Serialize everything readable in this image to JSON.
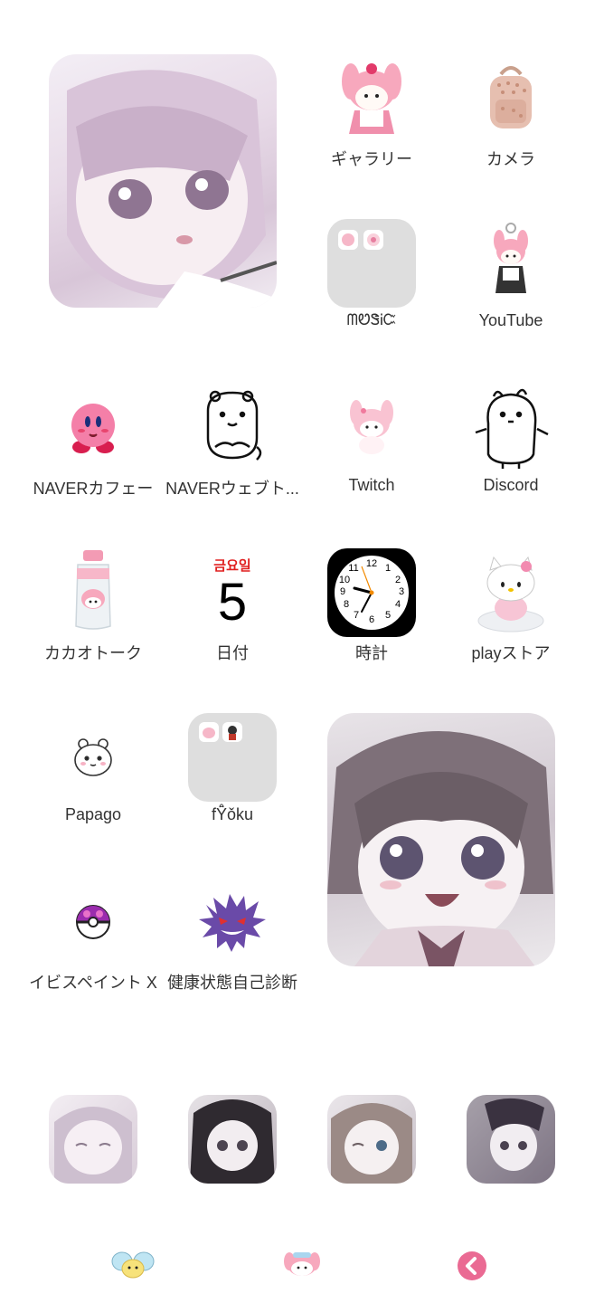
{
  "apps": {
    "gallery": "ギャラリー",
    "camera": "カメラ",
    "folder1": "ᗰᏬᏕᎥᏨ",
    "youtube": "YouTube",
    "naver_cafe": "NAVERカフェー",
    "naver_webtoon": "NAVERウェブト...",
    "twitch": "Twitch",
    "discord": "Discord",
    "kakaotalk": "カカオトーク",
    "date": "日付",
    "clock": "時計",
    "playstore": "playストア",
    "papago": "Papago",
    "folder2": "fŸ̊ǒku",
    "ibis": "イビスペイント X",
    "health": "健康状態自己診断"
  },
  "date_icon": {
    "weekday": "금요일",
    "day": "5"
  },
  "clock_numbers": [
    "12",
    "1",
    "2",
    "3",
    "4",
    "5",
    "6",
    "7",
    "8",
    "9",
    "10",
    "11"
  ],
  "colors": {
    "accent_pink": "#ea6a93",
    "folder_bg": "#dedede",
    "weekday_red": "#e02020"
  },
  "icons": [
    "my-melody-plush-icon",
    "backpack-icon",
    "folder-icon",
    "my-melody-keychain-icon",
    "kirby-icon",
    "bear-doodle-icon",
    "my-melody-small-icon",
    "bunny-doodle-icon",
    "bottle-icon",
    "calendar-icon",
    "clock-icon",
    "hello-kitty-icon",
    "chiikawa-icon",
    "pokeball-icon",
    "gengar-icon"
  ]
}
